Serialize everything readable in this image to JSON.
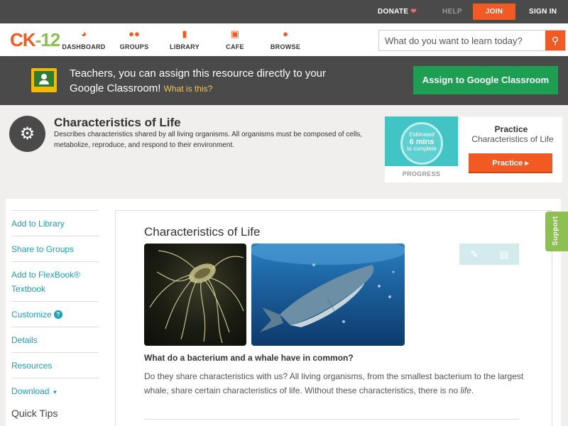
{
  "topbar": {
    "donate": "DONATE",
    "help": "HELP",
    "join": "JOIN",
    "signin": "SIGN IN"
  },
  "brand": {
    "logo_left": "CK",
    "logo_dash": "-",
    "logo_right": "12",
    "accent": "#f15a22",
    "green": "#8cc152"
  },
  "nav": {
    "items": [
      {
        "label": "DASHBOARD",
        "icon": "dashboard-icon"
      },
      {
        "label": "GROUPS",
        "icon": "groups-icon"
      },
      {
        "label": "LIBRARY",
        "icon": "library-icon"
      },
      {
        "label": "CAFE",
        "icon": "cafe-icon"
      },
      {
        "label": "BROWSE",
        "icon": "browse-icon"
      }
    ],
    "search_placeholder": "What do you want to learn today?"
  },
  "classroom": {
    "message": "Teachers, you can assign this resource directly to your Google Classroom!",
    "what": "What is this?",
    "button": "Assign to Google Classroom"
  },
  "topic": {
    "title": "Characteristics of Life",
    "description": "Describes characteristics shared by all living organisms. All organisms must be composed of cells, metabolize, reproduce, and respond to their environment.",
    "icon": "microscope-icon"
  },
  "practice": {
    "estimated": "Estimated",
    "mins": "6 mins",
    "to_complete": "to complete",
    "progress_label": "PROGRESS",
    "title": "Practice",
    "subtitle": "Characteristics of Life",
    "button": "Practice"
  },
  "sidebar": {
    "items": [
      "Add to Library",
      "Share to Groups",
      "Add to FlexBook® Textbook",
      "Customize",
      "Details",
      "Resources",
      "Download"
    ],
    "quick_tips": "Quick Tips"
  },
  "content": {
    "title": "Characteristics of Life",
    "question": "What do a bacterium and a whale have in common?",
    "paragraph_start": "Do they share characteristics with us? All living organisms, from the smallest bacterium to the largest whale, share certain characteristics of life. Without these characteristics, there is no ",
    "paragraph_em": "life",
    "paragraph_end": "."
  },
  "support": "Support"
}
